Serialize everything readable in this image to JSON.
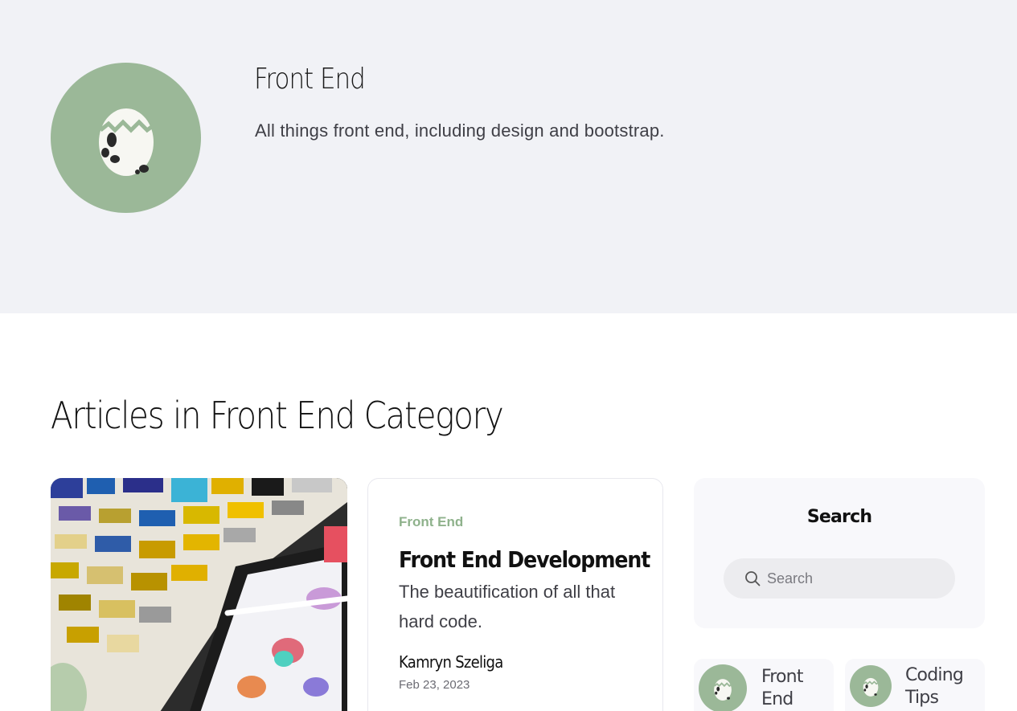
{
  "hero": {
    "title": "Front End",
    "description": "All things front end, including design and bootstrap."
  },
  "section": {
    "heading": "Articles in Front End Category"
  },
  "post": {
    "category": "Front End",
    "title": "Front End Development",
    "excerpt": "The beautification of all that hard code.",
    "author": "Kamryn Szeliga",
    "date": "Feb 23, 2023"
  },
  "search": {
    "title": "Search",
    "placeholder": "Search"
  },
  "categories": [
    {
      "label": "Front End",
      "icon": "egg-icon"
    },
    {
      "label": "Coding Tips",
      "icon": "egg-icon"
    }
  ],
  "colors": {
    "accent": "#9bb898",
    "hero_bg": "#f1f2f6",
    "category_text": "#8fb28c"
  }
}
